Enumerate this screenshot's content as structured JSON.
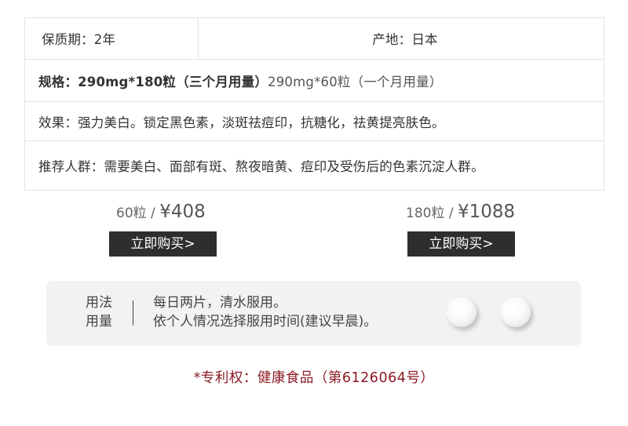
{
  "specs": {
    "shelf_life": "保质期：2年",
    "origin": "产地：日本",
    "spec_prefix": "规格：",
    "spec_strong": "290mg*180粒（三个月用量）",
    "spec_normal": "290mg*60粒（一个月用量）",
    "effect": "效果：强力美白。锁定黑色素，淡斑祛痘印，抗糖化，祛黄提亮肤色。",
    "target": "推荐人群：需要美白、面部有斑、熬夜暗黄、痘印及受伤后的色素沉淀人群。"
  },
  "offers": [
    {
      "qty": "60粒",
      "sep": " / ",
      "amount": "¥408",
      "button": "立即购买>"
    },
    {
      "qty": "180粒",
      "sep": " / ",
      "amount": "¥1088",
      "button": "立即购买>"
    }
  ],
  "usage": {
    "label_line1": "用法",
    "label_line2": "用量",
    "line1": "每日两片，清水服用。",
    "line2": "依个人情况选择服用时间(建议早晨)。"
  },
  "patent": "*专利权：健康食品（第6126064号）",
  "colors": {
    "patent_text": "#8b1a24",
    "button_bg": "#2e2e2e",
    "usage_bg": "#f2f2f2",
    "border": "#e4e4e4"
  },
  "icons": [
    "pill-icon",
    "pill-icon"
  ]
}
